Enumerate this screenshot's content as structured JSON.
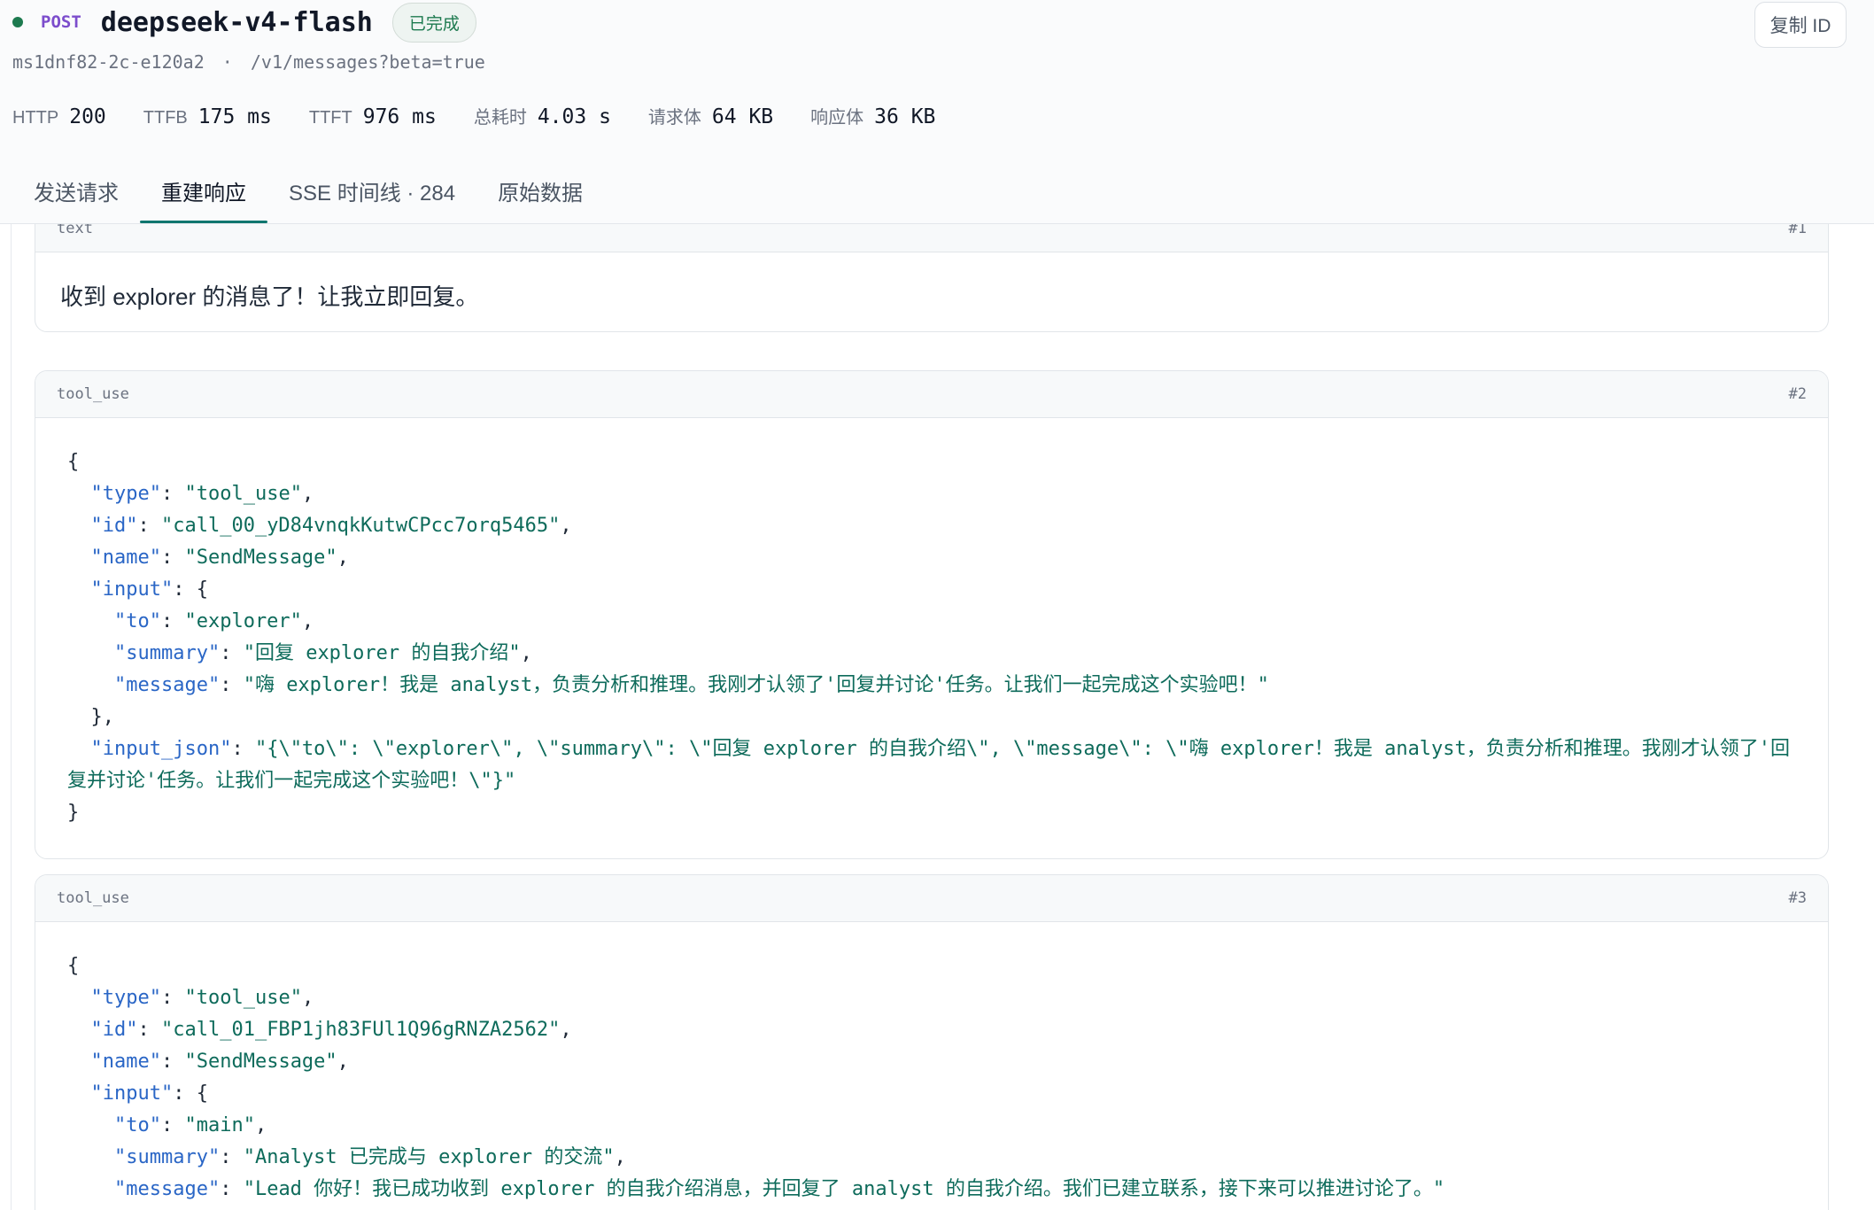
{
  "header": {
    "method": "POST",
    "model": "deepseek-v4-flash",
    "status": "已完成",
    "copy_button": "复制 ID",
    "request_id": "ms1dnf82-2c-e120a2",
    "separator": "·",
    "path": "/v1/messages?beta=true"
  },
  "metrics": [
    {
      "label": "HTTP",
      "value": "200"
    },
    {
      "label": "TTFB",
      "value": "175 ms"
    },
    {
      "label": "TTFT",
      "value": "976 ms"
    },
    {
      "label": "总耗时",
      "value": "4.03 s"
    },
    {
      "label": "请求体",
      "value": "64 KB"
    },
    {
      "label": "响应体",
      "value": "36 KB"
    }
  ],
  "tabs": [
    {
      "label": "发送请求"
    },
    {
      "label": "重建响应"
    },
    {
      "label": "SSE 时间线 · 284"
    },
    {
      "label": "原始数据"
    }
  ],
  "blocks": [
    {
      "type": "text",
      "index": "#1",
      "text": "收到 explorer 的消息了！让我立即回复。"
    },
    {
      "type": "tool_use",
      "index": "#2",
      "lines": {
        "open": "{",
        "type": "\"tool_use\"",
        "id": "\"call_00_yD84vnqkKutwCPcc7orq5465\"",
        "name": "\"SendMessage\"",
        "to": "\"explorer\"",
        "summary": "\"回复 explorer 的自我介绍\"",
        "message": "\"嗨 explorer！我是 analyst，负责分析和推理。我刚才认领了'回复并讨论'任务。让我们一起完成这个实验吧！\"",
        "input_json": "\"{\\\"to\\\": \\\"explorer\\\", \\\"summary\\\": \\\"回复 explorer 的自我介绍\\\", \\\"message\\\": \\\"嗨 explorer！我是 analyst，负责分析和推理。我刚才认领了'回复并讨论'任务。让我们一起完成这个实验吧！\\\"}\"",
        "close": "}"
      }
    },
    {
      "type": "tool_use",
      "index": "#3",
      "lines": {
        "open": "{",
        "type": "\"tool_use\"",
        "id": "\"call_01_FBP1jh83FUl1Q96gRNZA2562\"",
        "name": "\"SendMessage\"",
        "to": "\"main\"",
        "summary": "\"Analyst 已完成与 explorer 的交流\"",
        "message": "\"Lead 你好！我已成功收到 explorer 的自我介绍消息，并回复了 analyst 的自我介绍。我们已建立联系，接下来可以推进讨论了。\""
      }
    }
  ]
}
